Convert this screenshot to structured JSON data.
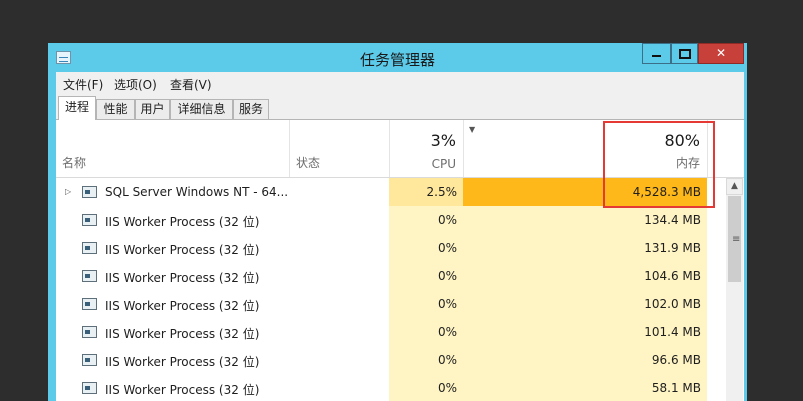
{
  "window": {
    "title": "任务管理器"
  },
  "menu": [
    "文件(F)",
    "选项(O)",
    "查看(V)"
  ],
  "tabs": [
    "进程",
    "性能",
    "用户",
    "详细信息",
    "服务"
  ],
  "header": {
    "name": "名称",
    "status": "状态",
    "cpu_pct": "3%",
    "cpu_label": "CPU",
    "mem_pct": "80%",
    "mem_label": "内存"
  },
  "processes": [
    {
      "name": "SQL Server Windows NT - 64...",
      "cpu": "2.5%",
      "memory": "4,528.3 MB",
      "expandable": true
    },
    {
      "name": "IIS Worker Process (32 位)",
      "cpu": "0%",
      "memory": "134.4 MB"
    },
    {
      "name": "IIS Worker Process (32 位)",
      "cpu": "0%",
      "memory": "131.9 MB"
    },
    {
      "name": "IIS Worker Process (32 位)",
      "cpu": "0%",
      "memory": "104.6 MB"
    },
    {
      "name": "IIS Worker Process (32 位)",
      "cpu": "0%",
      "memory": "102.0 MB"
    },
    {
      "name": "IIS Worker Process (32 位)",
      "cpu": "0%",
      "memory": "101.4 MB"
    },
    {
      "name": "IIS Worker Process (32 位)",
      "cpu": "0%",
      "memory": "96.6 MB"
    },
    {
      "name": "IIS Worker Process (32 位)",
      "cpu": "0%",
      "memory": "58.1 MB"
    }
  ],
  "colors": {
    "titlebar": "#5ccbea",
    "close_button": "#c7413a",
    "cpu_light": "#fff4c4",
    "cpu_medium": "#ffe79b",
    "mem_light": "#fff4c4",
    "mem_heavy": "#ffb81a",
    "annotation": "#e53935"
  }
}
